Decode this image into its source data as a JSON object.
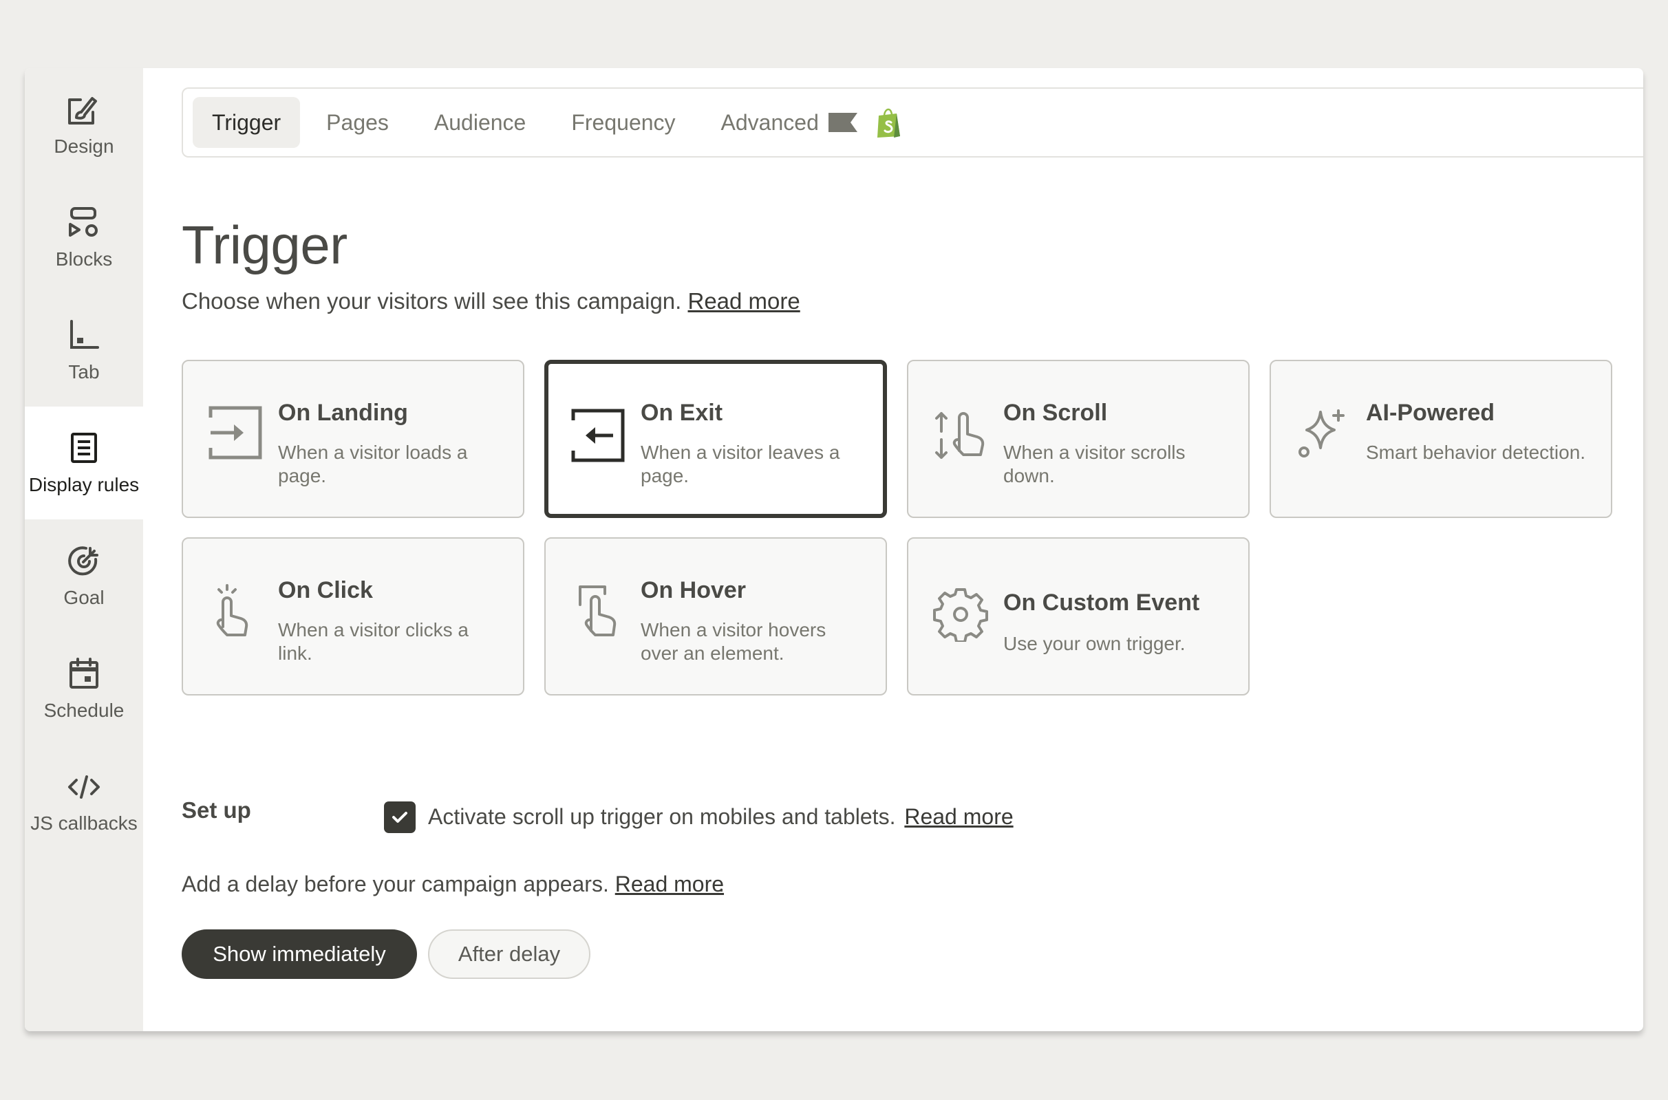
{
  "sidebar": {
    "items": [
      {
        "label": "Design",
        "icon": "design-icon"
      },
      {
        "label": "Blocks",
        "icon": "blocks-icon"
      },
      {
        "label": "Tab",
        "icon": "tab-icon"
      },
      {
        "label": "Display rules",
        "icon": "display-rules-icon",
        "active": true
      },
      {
        "label": "Goal",
        "icon": "goal-icon"
      },
      {
        "label": "Schedule",
        "icon": "calendar-icon"
      },
      {
        "label": "JS callbacks",
        "icon": "code-icon"
      }
    ]
  },
  "tabs": [
    {
      "label": "Trigger",
      "active": true
    },
    {
      "label": "Pages"
    },
    {
      "label": "Audience"
    },
    {
      "label": "Frequency"
    },
    {
      "label": "Advanced"
    }
  ],
  "icons": {
    "advanced_flag": "flag-icon",
    "shopify": "shopify-bag-icon"
  },
  "page": {
    "title": "Trigger",
    "subtitle": "Choose when your visitors will see this campaign.",
    "subtitle_link": "Read more"
  },
  "triggers": [
    {
      "title": "On Landing",
      "desc": "When a visitor loads a page.",
      "icon": "enter-icon"
    },
    {
      "title": "On Exit",
      "desc": "When a visitor leaves a page.",
      "icon": "exit-icon",
      "selected": true
    },
    {
      "title": "On Scroll",
      "desc": "When a visitor scrolls down.",
      "icon": "scroll-hand-icon"
    },
    {
      "title": "AI-Powered",
      "desc": "Smart behavior detection.",
      "icon": "sparkle-icon"
    },
    {
      "title": "On Click",
      "desc": "When a visitor clicks a link.",
      "icon": "click-hand-icon"
    },
    {
      "title": "On Hover",
      "desc": "When a visitor hovers over an element.",
      "icon": "hover-hand-icon"
    },
    {
      "title": "On Custom Event",
      "desc": "Use your own trigger.",
      "icon": "gear-icon"
    }
  ],
  "setup": {
    "label": "Set up",
    "checkbox_checked": true,
    "checkbox_label": "Activate scroll up trigger on mobiles and tablets.",
    "checkbox_link": "Read more"
  },
  "delay": {
    "text": "Add a delay before your campaign appears.",
    "link": "Read more",
    "suffix": ".",
    "options": [
      "Show immediately",
      "After delay"
    ],
    "selected": "Show immediately"
  },
  "colors": {
    "accent": "#3a3a35",
    "background": "#efeeeb",
    "text": "#4a4a46",
    "muted": "#77776f"
  }
}
